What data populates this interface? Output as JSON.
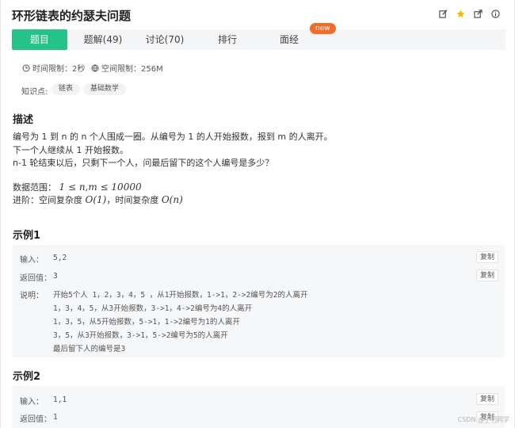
{
  "problem": {
    "title": "环形链表的约瑟夫问题"
  },
  "header_icons": [
    "edit-icon",
    "star-icon",
    "share-icon",
    "info-icon"
  ],
  "colors": {
    "accent": "#25c28a",
    "new_badge": "#f36b2b",
    "star": "#f5b700"
  },
  "tabs": [
    {
      "label": "题目",
      "active": true
    },
    {
      "label": "题解(49)",
      "active": false
    },
    {
      "label": "讨论(70)",
      "active": false
    },
    {
      "label": "排行",
      "active": false
    },
    {
      "label": "面经",
      "active": false
    }
  ],
  "new_badge": "new",
  "limits": {
    "time": "时间限制：2秒",
    "space": "空间限制：256M"
  },
  "knowledge": {
    "label": "知识点:",
    "tags": [
      "链表",
      "基础数学"
    ]
  },
  "description": {
    "heading": "描述",
    "lines": [
      "编号为 1 到 n 的 n 个人围成一圈。从编号为 1 的人开始报数，报到 m 的人离开。",
      "下一个人继续从 1 开始报数。",
      "n-1 轮结束以后，只剩下一个人，问最后留下的这个人编号是多少？"
    ],
    "range_label": "数据范围：",
    "range_math": "1 ≤ n,m ≤ 10000",
    "advanced_label": "进阶：空间复杂度",
    "space_complexity": "O(1)",
    "time_label": "，时间复杂度",
    "time_complexity": "O(n)"
  },
  "examples": [
    {
      "heading": "示例1",
      "input_label": "输入：",
      "input": "5,2",
      "return_label": "返回值：",
      "return": "3",
      "explain_label": "说明：",
      "explain_lines": [
        "开始5个人 1，2，3，4，5 ，从1开始报数，1->1，2->2编号为2的人离开",
        "1，3，4，5，从3开始报数，3->1，4->2编号为4的人离开",
        "1，3，5，从5开始报数，5->1，1->2编号为1的人离开",
        "3，5，从3开始报数，3->1，5->2编号为5的人离开",
        "最后留下人的编号是3"
      ],
      "copy_label": "复制"
    },
    {
      "heading": "示例2",
      "input_label": "输入：",
      "input": "1,1",
      "return_label": "返回值：",
      "return": "1",
      "copy_label": "复制"
    }
  ],
  "watermark": "CSDN @小明同学"
}
